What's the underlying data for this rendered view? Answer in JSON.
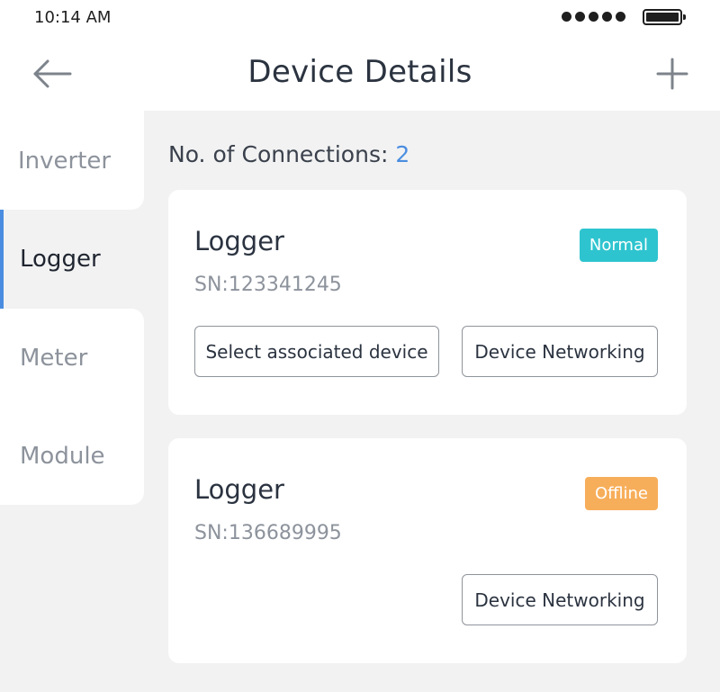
{
  "status_bar": {
    "time": "10:14 AM"
  },
  "nav": {
    "title": "Device Details",
    "back_icon": "arrow-left-icon",
    "add_icon": "plus-icon"
  },
  "sidebar": {
    "items": [
      {
        "label": "Inverter"
      },
      {
        "label": "Logger",
        "active": true
      },
      {
        "label": "Meter"
      },
      {
        "label": "Module"
      }
    ]
  },
  "connections": {
    "label": "No. of Connections:",
    "count": "2"
  },
  "devices": [
    {
      "name": "Logger",
      "sn": "SN:123341245",
      "status": "Normal",
      "select_button": "Select associated device",
      "network_button": "Device Networking"
    },
    {
      "name": "Logger",
      "sn": "SN:136689995",
      "status": "Offline",
      "network_button": "Device Networking"
    }
  ],
  "colors": {
    "accent": "#4a8de0",
    "status_normal": "#2ec4cf",
    "status_offline": "#f7ae5a",
    "background": "#f2f2f2"
  }
}
